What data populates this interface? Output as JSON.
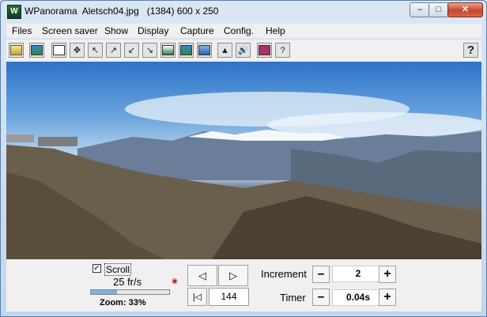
{
  "window": {
    "title": "WPanorama  Aletsch04.jpg   (1384) 600 x 250",
    "app_icon": "wpanorama-app-icon",
    "controls": {
      "minimize": "–",
      "maximize": "□",
      "close": "✕"
    }
  },
  "menu": [
    "Files",
    "Screen saver",
    "Show",
    "Display",
    "Capture",
    "Config.",
    "Help"
  ],
  "toolbar": {
    "buttons": [
      "open-icon",
      "image-icon",
      "copy-icon",
      "move-icon",
      "arrow-up-left-icon",
      "arrow-up-right-icon",
      "arrow-down-left-icon",
      "arrow-down-right-icon",
      "panorama-icon",
      "landscape-icon",
      "horizon-icon",
      "mountain-icon",
      "sound-icon",
      "book-icon",
      "help-book-icon"
    ],
    "help_label": "?"
  },
  "image": {
    "alt": ""
  },
  "controls": {
    "scroll_checked": "✓",
    "scroll_label": "Scroll",
    "speed": "25 fr/s",
    "zoom_label": "Zoom: 33%",
    "zoom_fraction": 0.33,
    "prev": "◁",
    "next": "▷",
    "first": "|◁",
    "frame": "144",
    "increment_label": "Increment",
    "increment_value": "2",
    "timer_label": "Timer",
    "timer_value": "0.04s",
    "minus": "–",
    "plus": "+"
  }
}
